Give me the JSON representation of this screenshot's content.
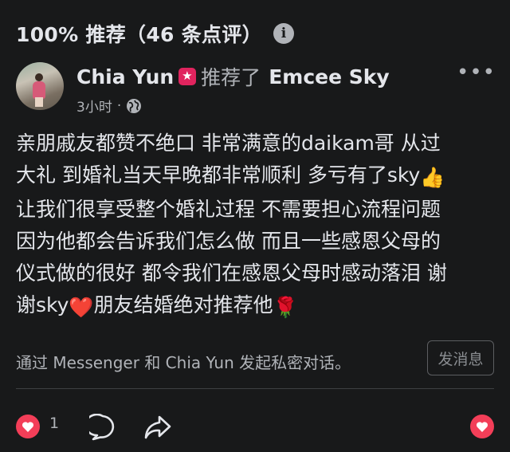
{
  "header": {
    "title": "100% 推荐（46 条点评）",
    "info_icon": "info-icon"
  },
  "post": {
    "author": "Chia Yun",
    "action": "推荐了",
    "page": "Emcee Sky",
    "time": "3小时",
    "separator": "·",
    "privacy_icon": "globe-icon",
    "body_lines": [
      "亲朋戚友都赞不绝口 非常满意的daikam哥 从过",
      "大礼 到婚礼当天早晚都非常顺利 多亏有了sky",
      "让我们很享受整个婚礼过程 不需要担心流程问题",
      "因为他都会告诉我们怎么做 而且一些感恩父母的",
      "仪式做的很好 都令我们在感恩父母时感动落泪 谢",
      "谢sky",
      "朋友结婚绝对推荐他"
    ],
    "emojis": {
      "thumbs": "👍",
      "heart": "❤️",
      "rose": "🌹"
    }
  },
  "messenger": {
    "prompt": "通过 Messenger 和 Chia Yun 发起私密对话。",
    "button_label": "发消息"
  },
  "actions": {
    "reaction_count": "1"
  },
  "colors": {
    "background": "#18191a",
    "text": "#e4e6eb",
    "muted": "#b0b3b8",
    "love": "#f33e58"
  }
}
